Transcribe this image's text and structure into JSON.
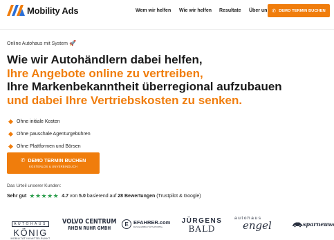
{
  "nav": {
    "logo_text": "Mobility Ads",
    "links": [
      "Wem wir helfen",
      "Wie wir helfen",
      "Resultate",
      "Über uns"
    ],
    "cta_label": "DEMO TERMIN BUCHEN"
  },
  "hero": {
    "eyebrow": "Online Autohaus mit System",
    "headline": {
      "line1": "Wie wir Autohändlern dabei helfen,",
      "line2": "Ihre Angebote online zu vertreiben,",
      "line3": "Ihre Markenbekanntheit überregional aufzubauen",
      "line4": "und dabei Ihre Vertriebskosten zu senken."
    },
    "bullets": [
      "Ohne initiale Kosten",
      "Ohne pauschale Agenturgebühren",
      "Ohne Plattformen und Börsen"
    ],
    "cta": {
      "label": "DEMO TERMIN BUCHEN",
      "sublabel": "KOSTENLOS & UNVERBINDLICH"
    }
  },
  "rating": {
    "intro": "Das Urteil unserer Kunden:",
    "verdict": "Sehr gut",
    "stars": "★★★★★",
    "score": "4.7",
    "of_text": "von",
    "max": "5.0",
    "based_text": "basierend auf",
    "count_text": "28 Bewertungen",
    "source": "(Trustpilot & Google)"
  },
  "logos": {
    "koenig": {
      "top": "AUTOHAUS",
      "main": "KÖNIG",
      "tag": "MOBILITÄT IM MITTELPUNKT"
    },
    "volvo": {
      "line1": "VOLVO CENTRUM",
      "line2": "RHEIN RUHR GMBH"
    },
    "efahrer": {
      "mark": "E",
      "name": "EFAHRER.com",
      "tag": "DAS E-MOBILITÄTS-PORTAL"
    },
    "juergens": {
      "line1": "JÜRGENS",
      "line2": "BALD"
    },
    "engel": {
      "line1": "autohaus",
      "line2": "engel"
    },
    "spar": {
      "name": "sparneuwagen"
    }
  },
  "colors": {
    "accent": "#f07d0c",
    "text": "#1a1a1a",
    "stars": "#2e9e4e"
  }
}
